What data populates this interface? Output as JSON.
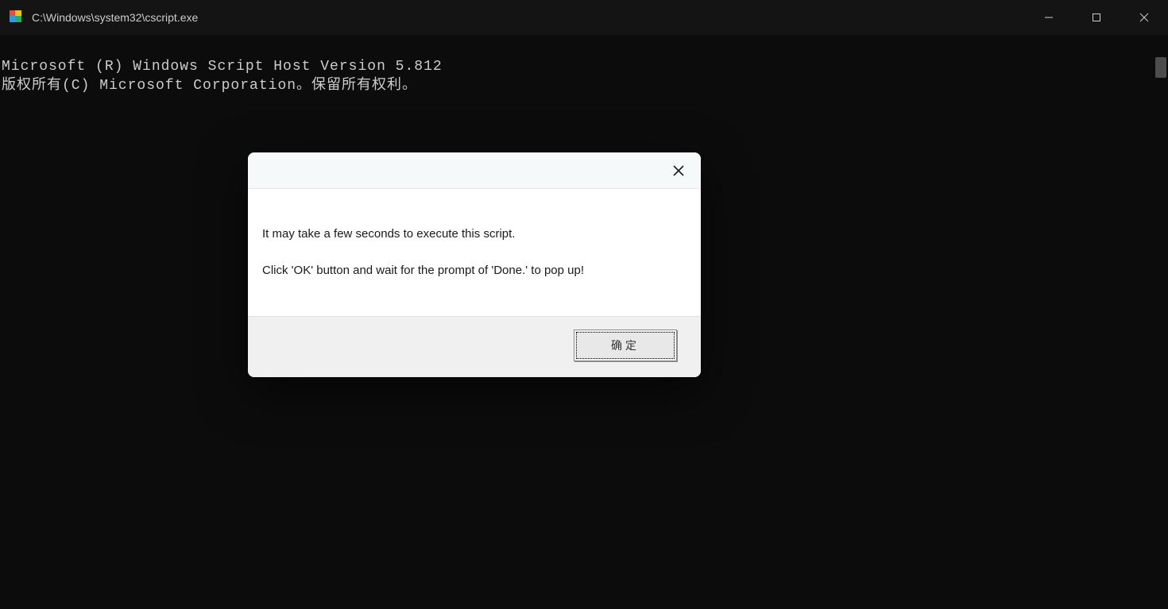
{
  "titlebar": {
    "path": "C:\\Windows\\system32\\cscript.exe"
  },
  "console": {
    "line1": "Microsoft (R) Windows Script Host Version 5.812",
    "line2": "版权所有(C) Microsoft Corporation。保留所有权利。"
  },
  "dialog": {
    "message_line1": "It may take a few seconds to execute this script.",
    "message_line2": "Click 'OK' button and wait for the prompt of 'Done.' to pop up!",
    "ok_label": "确定"
  }
}
